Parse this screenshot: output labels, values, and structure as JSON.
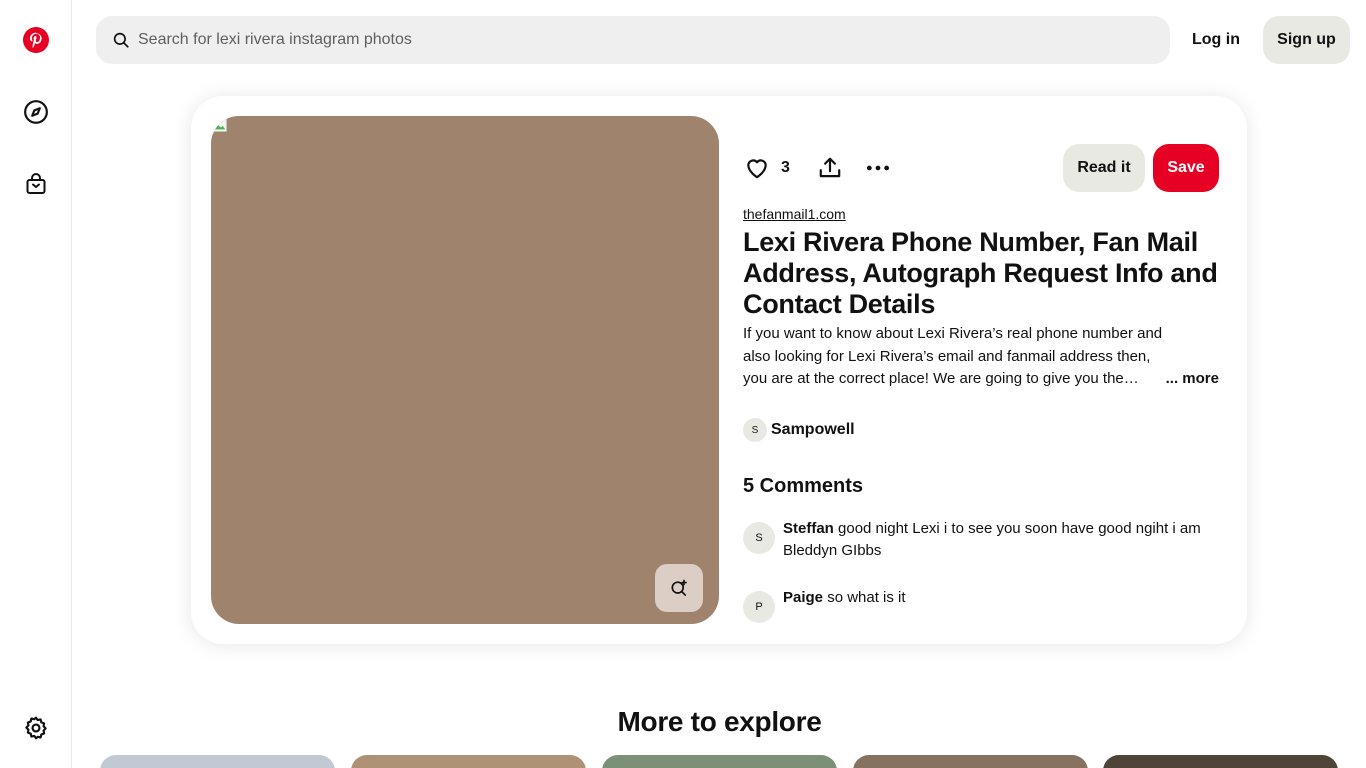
{
  "search": {
    "placeholder": "Search for lexi rivera instagram photos"
  },
  "header": {
    "login_label": "Log in",
    "signup_label": "Sign up"
  },
  "rail": {
    "items": [
      {
        "name": "pinterest-logo-icon"
      },
      {
        "name": "compass-icon"
      },
      {
        "name": "shopping-bag-icon"
      },
      {
        "name": "settings-gear-icon"
      }
    ]
  },
  "pin": {
    "like_count": "3",
    "read_label": "Read it",
    "save_label": "Save",
    "source": "thefanmail1.com",
    "title": "Lexi Rivera Phone Number, Fan Mail Address, Autograph Request Info and Contact Details",
    "description": "If you want to know about Lexi Rivera’s real phone number and also looking for Lexi Rivera’s email and fanmail address then, you are at the correct place! We are going to give you the contact details.",
    "more_label": "... more",
    "creator": {
      "initial": "S",
      "name": "Sampowell"
    },
    "image_color": "#a0836d"
  },
  "comments": {
    "heading": "5 Comments",
    "items": [
      {
        "initial": "S",
        "author": "Steffan",
        "text": " good night Lexi i to see you soon have good ngiht i am Bleddyn GIbbs"
      },
      {
        "initial": "P",
        "author": "Paige",
        "text": " so what is it"
      }
    ]
  },
  "explore": {
    "heading": "More to explore",
    "tiles": [
      {
        "color": "#c3c9d3"
      },
      {
        "color": "#ae9276"
      },
      {
        "color": "#7c9078"
      },
      {
        "color": "#86725f"
      },
      {
        "color": "#4e4538"
      }
    ]
  },
  "colors": {
    "brand_red": "#e60023",
    "secondary_button": "#e9e9e4",
    "search_bg": "#efefef"
  }
}
